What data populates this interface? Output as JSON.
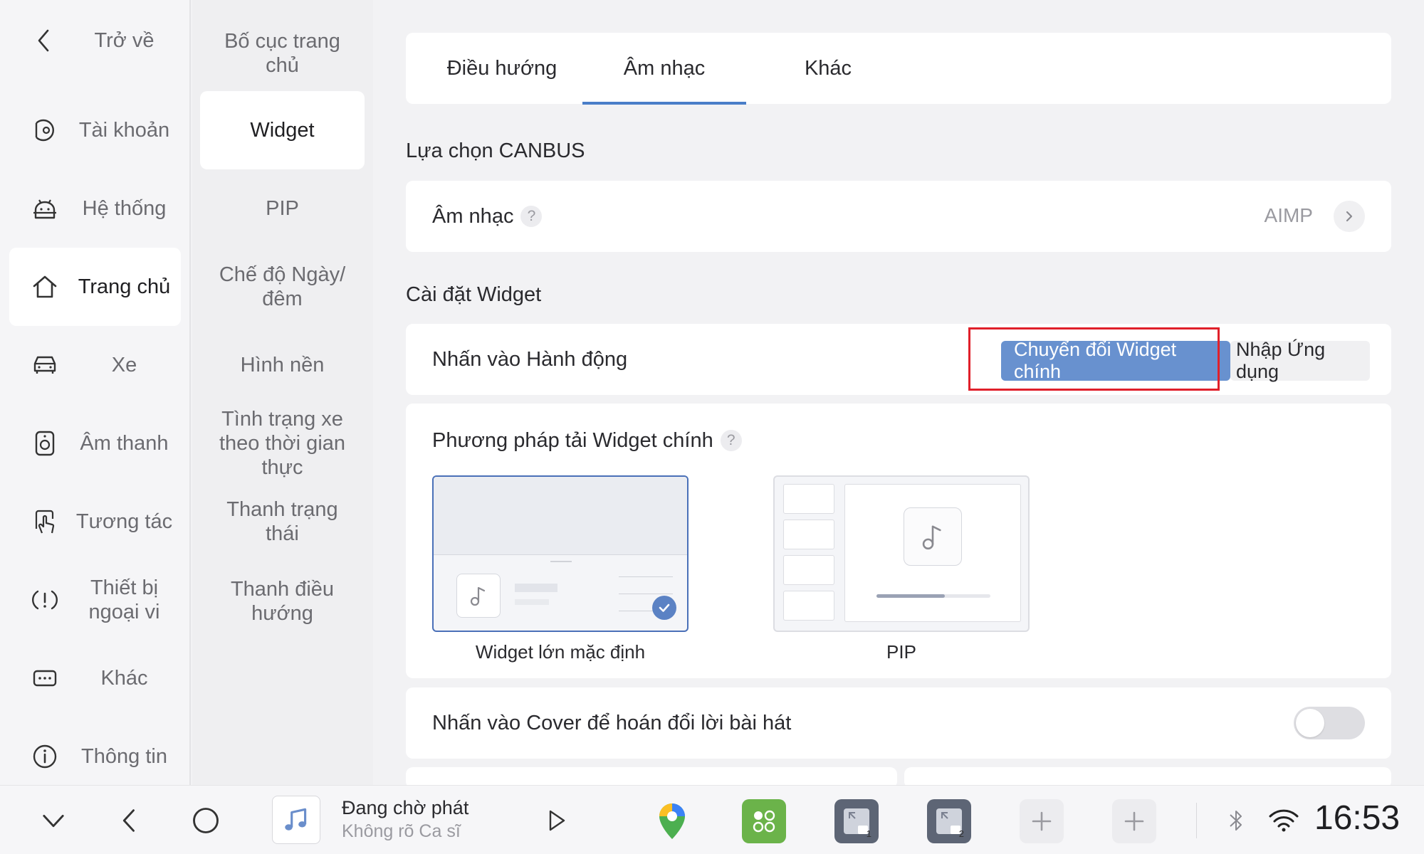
{
  "nav_primary": [
    {
      "label": "Trở về",
      "icon": "back-arrow-icon"
    },
    {
      "label": "Tài khoản",
      "icon": "account-icon"
    },
    {
      "label": "Hệ thống",
      "icon": "android-icon"
    },
    {
      "label": "Trang chủ",
      "icon": "home-icon",
      "active": true
    },
    {
      "label": "Xe",
      "icon": "car-icon"
    },
    {
      "label": "Âm thanh",
      "icon": "speaker-icon"
    },
    {
      "label": "Tương tác",
      "icon": "touch-icon"
    },
    {
      "label": "Thiết bị ngoại vi",
      "icon": "peripheral-icon"
    },
    {
      "label": "Khác",
      "icon": "more-icon"
    },
    {
      "label": "Thông tin",
      "icon": "info-icon"
    }
  ],
  "nav_secondary": [
    {
      "label": "Bố cục trang chủ"
    },
    {
      "label": "Widget",
      "active": true
    },
    {
      "label": "PIP"
    },
    {
      "label": "Chế độ Ngày/ đêm"
    },
    {
      "label": "Hình nền"
    },
    {
      "label": "Tình trạng xe theo thời gian thực"
    },
    {
      "label": "Thanh trạng thái"
    },
    {
      "label": "Thanh điều hướng"
    }
  ],
  "tabs": [
    {
      "label": "Điều hướng"
    },
    {
      "label": "Âm nhạc",
      "active": true
    },
    {
      "label": "Khác"
    }
  ],
  "canbus": {
    "section_title": "Lựa chọn CANBUS",
    "row_label": "Âm nhạc",
    "help": "?",
    "value": "AIMP"
  },
  "widget_settings": {
    "section_title": "Cài đặt Widget",
    "action_label": "Nhấn vào Hành động",
    "action_options": [
      "Chuyển đổi Widget chính",
      "Nhập Ứng dụng"
    ],
    "action_selected": "Chuyển đổi Widget chính",
    "load_method_label": "Phương pháp tải Widget chính",
    "load_help": "?",
    "load_options": [
      {
        "label": "Widget lớn mặc định",
        "selected": true
      },
      {
        "label": "PIP",
        "selected": false
      }
    ],
    "cover_toggle_label": "Nhấn vào Cover để hoán đổi lời bài hát",
    "cover_toggle_on": false
  },
  "bottom_bar": {
    "media_title": "Đang chờ phát",
    "media_artist": "Không rõ Ca sĩ",
    "app_badges": [
      "1",
      "2"
    ],
    "time": "16:53"
  },
  "colors": {
    "accent": "#6891cf",
    "tab_underline": "#4a7ec8",
    "highlight": "#e0202a",
    "app_green": "#6bb34a"
  }
}
